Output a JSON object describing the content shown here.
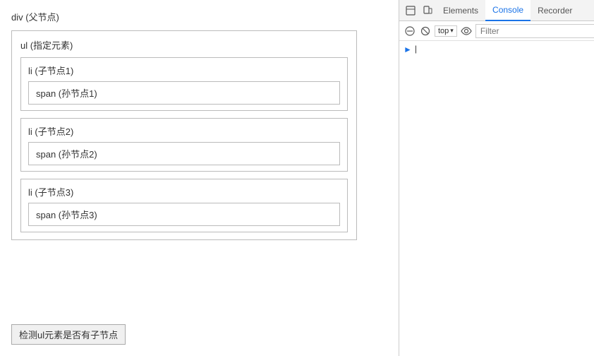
{
  "main": {
    "div_label": "div (父节点)",
    "ul_label": "ul (指定元素)",
    "items": [
      {
        "li_label": "li (子节点1)",
        "span_label": "span (孙节点1)"
      },
      {
        "li_label": "li (子节点2)",
        "span_label": "span (孙节点2)"
      },
      {
        "li_label": "li (子节点3)",
        "span_label": "span (孙节点3)"
      }
    ],
    "check_button_label": "检测ul元素是否有子节点"
  },
  "devtools": {
    "tabs": [
      {
        "id": "elements",
        "label": "Elements"
      },
      {
        "id": "console",
        "label": "Console"
      },
      {
        "id": "recorder",
        "label": "Recorder"
      }
    ],
    "active_tab": "Console",
    "toolbar": {
      "top_label": "top",
      "filter_placeholder": "Filter"
    },
    "icons": {
      "inspect": "⊡",
      "device": "⊞",
      "prohibit": "⊘",
      "eye": "👁",
      "chevron_down": "▾",
      "sidebar": "⊡",
      "dock": "⊞"
    }
  }
}
